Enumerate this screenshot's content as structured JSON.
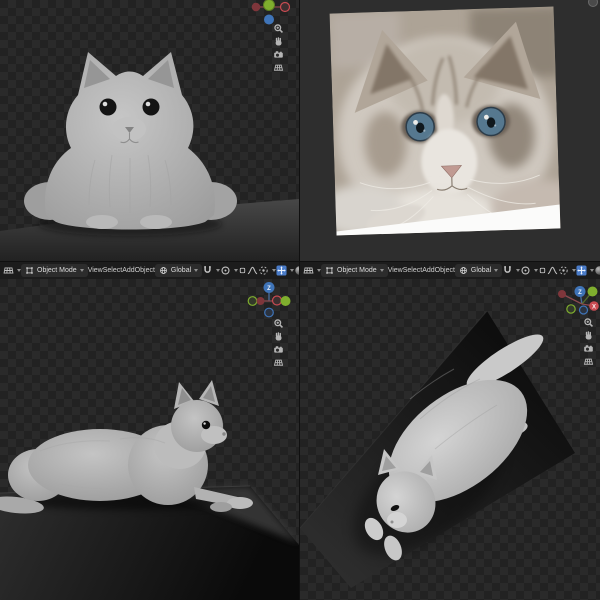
{
  "editor": {
    "mode_label": "Object Mode",
    "menus": [
      "View",
      "Select",
      "Add",
      "Object"
    ],
    "orientation_label": "Global"
  },
  "gizmo": {
    "axis_x_label": "X",
    "axis_z_label": "Z",
    "axis_colors": {
      "x": "#c84b52",
      "y": "#7fae2e",
      "z": "#3f74b8"
    }
  },
  "viewport_nav_icons": [
    "zoom-icon",
    "move-hand-icon",
    "camera-view-icon",
    "orthographic-grid-icon"
  ],
  "toolbar_icons": [
    "editor-type-icon",
    "object-mode-icon",
    "global-orientation-icon",
    "snap-magnet-icon",
    "proportional-editing-icon",
    "snap-target-icon",
    "proportional-falloff-icon",
    "pivot-point-icon",
    "gizmo-toggle-icon",
    "overlays-sphere-icon",
    "shading-sphere-icon"
  ],
  "colors": {
    "accent_blue": "#4a7cc9",
    "toolbar_bg": "#1c1c1c",
    "checker_dark": "#222222",
    "checker_light": "#2a2a2a",
    "reference_panel_bg": "#2e2e2e",
    "model_gray": "#b5b5b5",
    "platform_gray": "#3a3a3a",
    "eye_blue": "#56788f"
  },
  "views": {
    "top_left": "front render of gray cat model on pedestal",
    "top_right": "reference photo: ragdoll cat face with blue eyes",
    "bottom_left": "side view: cat model lying on dark block",
    "bottom_right": "top view: cat model lying on dark plane"
  }
}
